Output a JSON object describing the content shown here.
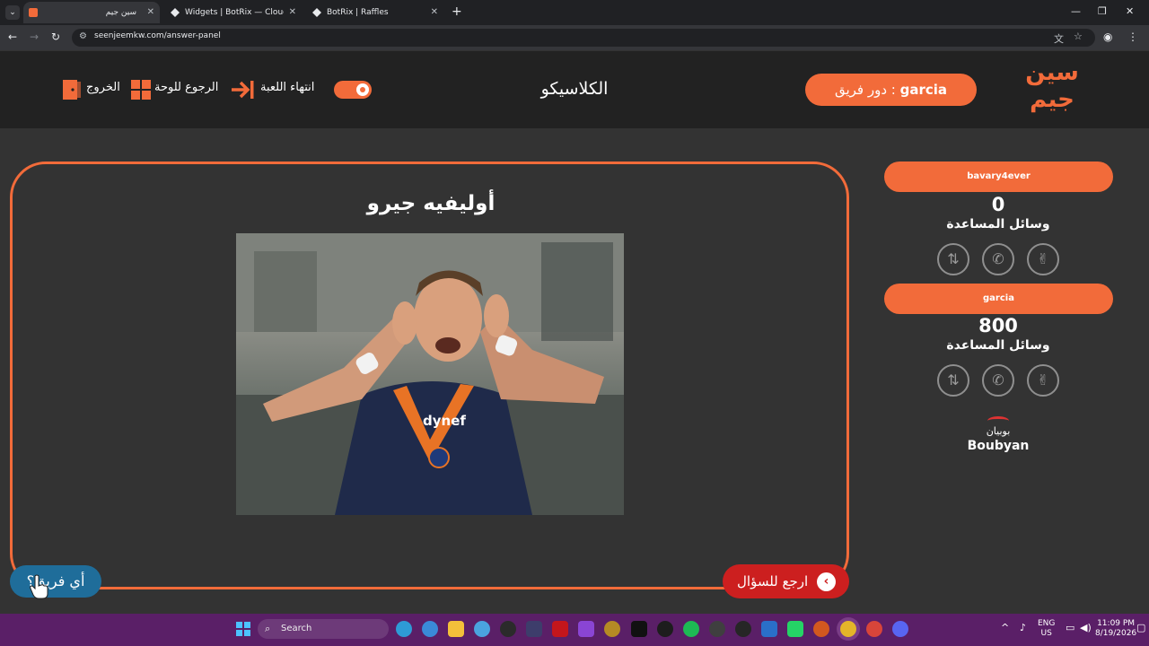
{
  "browser": {
    "tabs": [
      {
        "title": "سين جيم",
        "active": true
      },
      {
        "title": "Widgets | BotRix — Cloud Strea",
        "active": false
      },
      {
        "title": "BotRix | Raffles",
        "active": false
      }
    ],
    "url": "seenjeemkw.com/answer-panel"
  },
  "header": {
    "logo_text": "سين جيم",
    "turn_prefix": "دور فريق : ",
    "turn_team": "garcia",
    "category": "الكلاسيكو",
    "end_game": "انتهاء اللعبة",
    "back_to_board": "الرجوع للوحة",
    "exit": "الخروج"
  },
  "question": {
    "answer": "أوليفيه جيرو",
    "back_to_question": "ارجع للسؤال",
    "which_team": "أي فريق؟"
  },
  "teams": [
    {
      "name": "bavary4ever",
      "score": "0",
      "aids_label": "وسائل المساعدة"
    },
    {
      "name": "garcia",
      "score": "800",
      "aids_label": "وسائل المساعدة"
    }
  ],
  "sponsor": {
    "arabic": "بوبيان",
    "english": "Boubyan"
  },
  "taskbar": {
    "search_placeholder": "Search",
    "lang_top": "ENG",
    "lang_bottom": "US",
    "time": "11:09 PM",
    "date": "8/19/2026"
  },
  "colors": {
    "accent": "#f26b3a",
    "back_button": "#cc1f1f",
    "team_button": "#1f6d9a",
    "taskbar": "#5a1f67"
  }
}
